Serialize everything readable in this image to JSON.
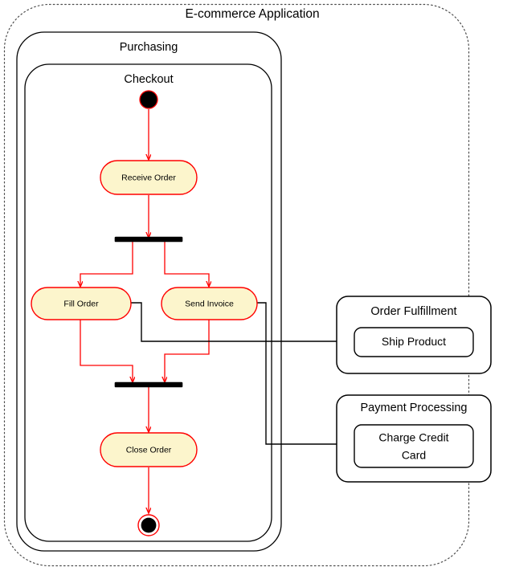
{
  "diagram": {
    "type": "uml-activity-diagram",
    "outer_boundary": {
      "label": "E-commerce Application"
    },
    "package": {
      "label": "Purchasing"
    },
    "activity": {
      "label": "Checkout"
    },
    "nodes": {
      "initial": {
        "name": "initial-node",
        "label": ""
      },
      "receive_order": {
        "label": "Receive Order"
      },
      "fork": {
        "name": "fork-bar",
        "label": ""
      },
      "fill_order": {
        "label": "Fill Order"
      },
      "send_invoice": {
        "label": "Send Invoice"
      },
      "join": {
        "name": "join-bar",
        "label": ""
      },
      "close_order": {
        "label": "Close Order"
      },
      "final": {
        "name": "final-node",
        "label": ""
      }
    },
    "external_partitions": [
      {
        "title": "Order Fulfillment",
        "action": "Ship Product"
      },
      {
        "title": "Payment Processing",
        "action_line1": "Charge Credit",
        "action_line2": "Card"
      }
    ],
    "colors": {
      "action_fill": "#fcf5cc",
      "action_stroke": "#ff0000",
      "control_flow": "#ff0000",
      "external_flow": "#000000",
      "boundary_stroke": "#000000",
      "outer_boundary_stroke": "#4d4d4d",
      "bar_fill": "#000000",
      "canvas": "#ffffff"
    }
  }
}
